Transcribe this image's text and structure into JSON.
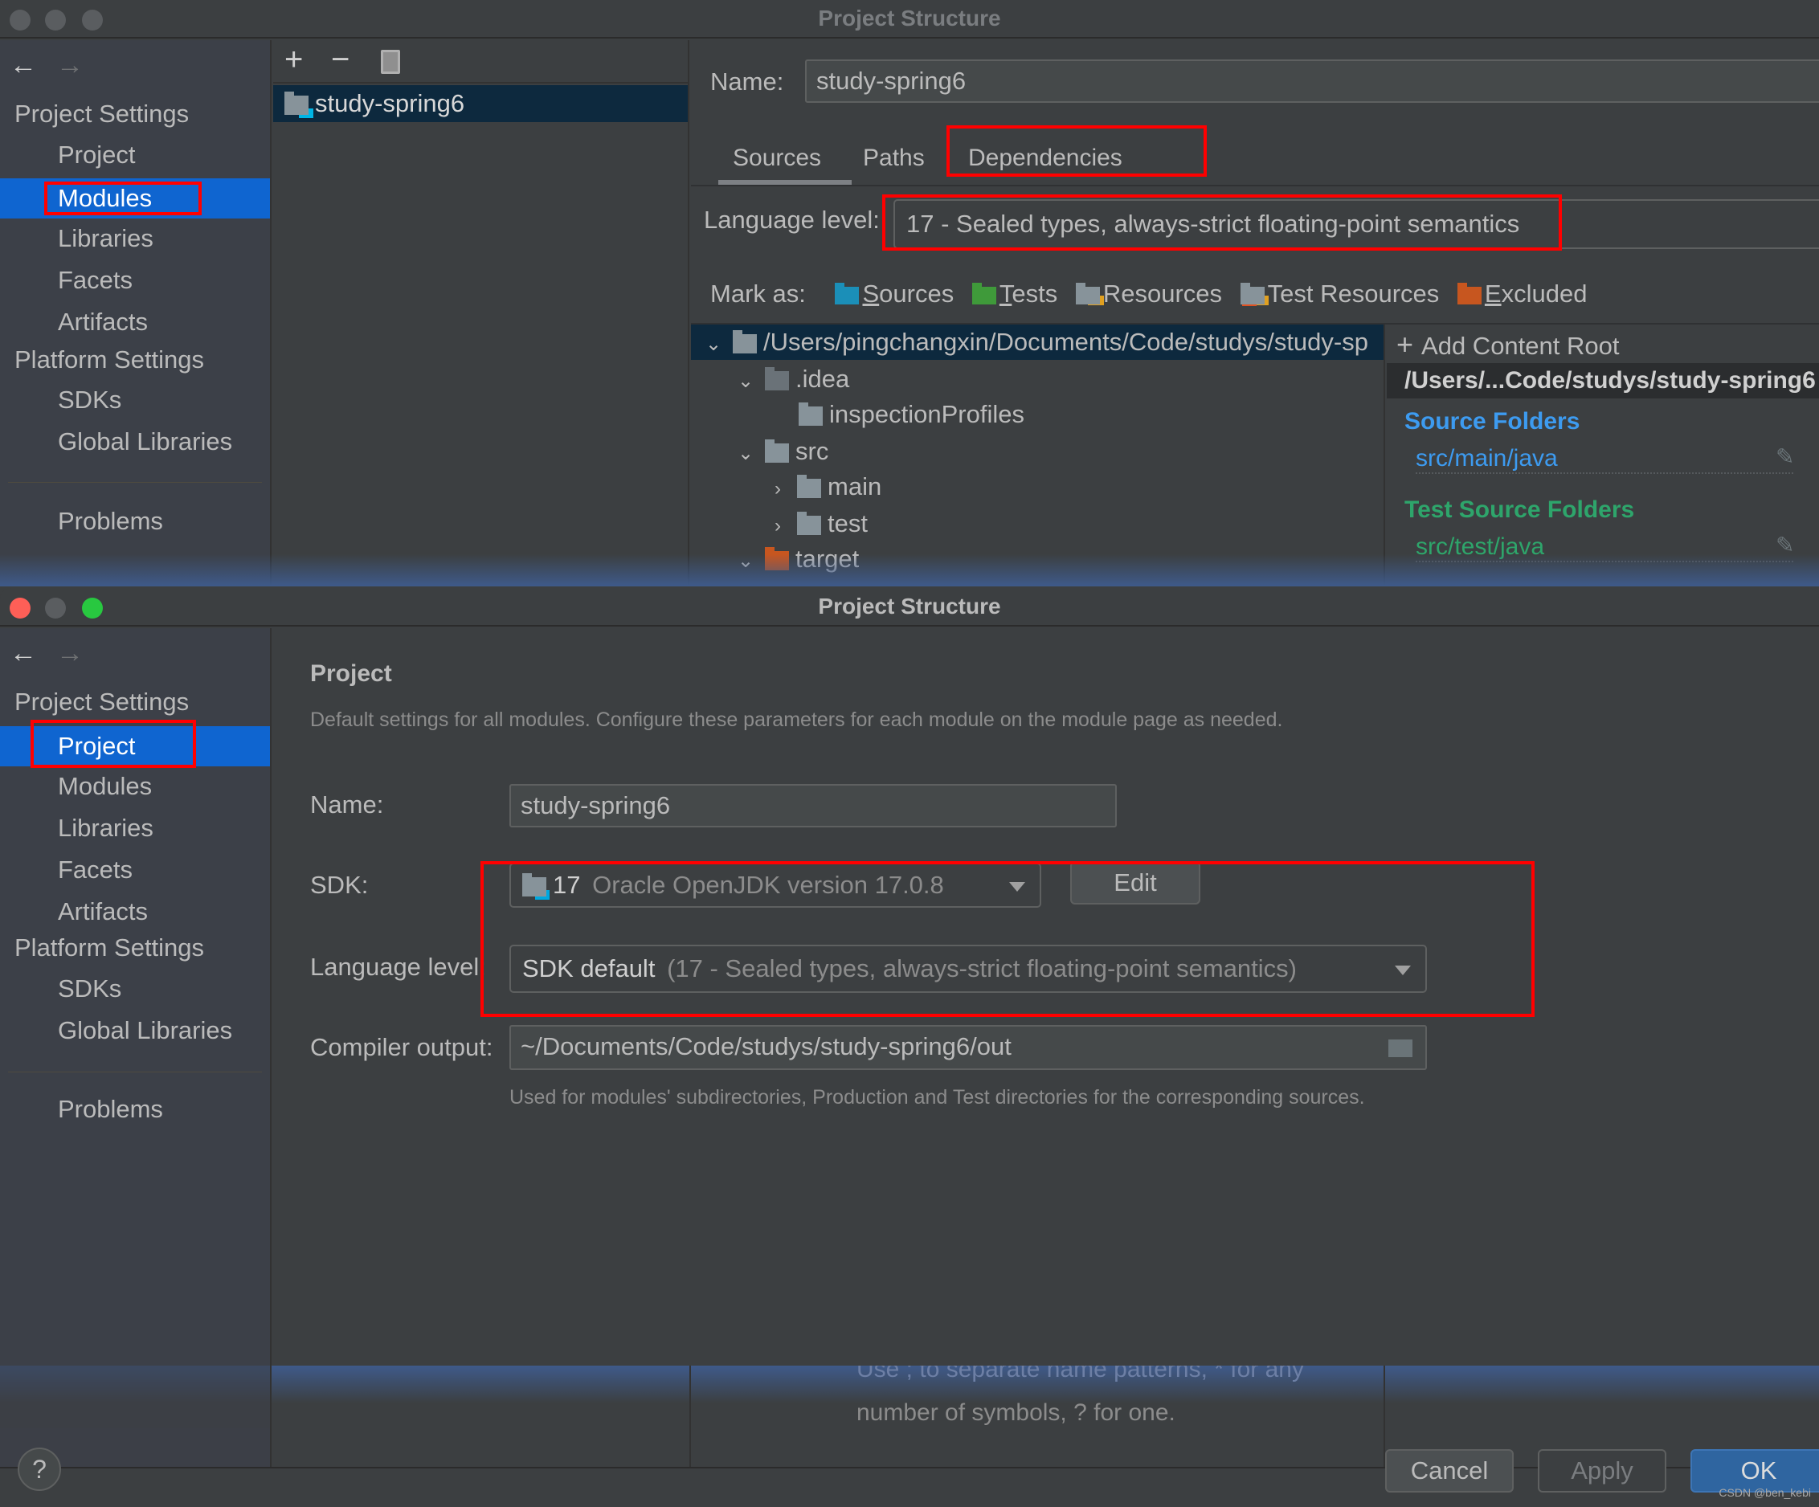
{
  "window_title": "Project Structure",
  "colors": {
    "accent_selection": "#0f65d0",
    "highlight_box": "#ff0000",
    "source_blue": "#3d9bf0",
    "test_green": "#2ea56b",
    "excluded_orange": "#c7561f",
    "ok_button": "#2f65a0"
  },
  "sidebar": {
    "sections": [
      {
        "heading": "Project Settings",
        "items": [
          "Project",
          "Modules",
          "Libraries",
          "Facets",
          "Artifacts"
        ]
      },
      {
        "heading": "Platform Settings",
        "items": [
          "SDKs",
          "Global Libraries"
        ]
      }
    ],
    "problems": "Problems"
  },
  "top_window": {
    "selected_sidebar": "Modules",
    "toolbar": {
      "add": "+",
      "remove": "−",
      "copy": "copy-icon"
    },
    "module_list": [
      "study-spring6"
    ],
    "name_label": "Name:",
    "name_value": "study-spring6",
    "tabs": [
      "Sources",
      "Paths",
      "Dependencies"
    ],
    "active_tab": "Sources",
    "language_level_label": "Language level:",
    "language_level_value": "17 - Sealed types, always-strict floating-point semantics",
    "mark_as_label": "Mark as:",
    "mark_as": [
      {
        "label": "Sources",
        "mnemonic": "S",
        "rest": "ources"
      },
      {
        "label": "Tests",
        "mnemonic": "T",
        "rest": "ests"
      },
      {
        "label": "Resources",
        "mnemonic": "",
        "rest": "Resources"
      },
      {
        "label": "Test Resources",
        "mnemonic": "",
        "rest": "Test Resources"
      },
      {
        "label": "Excluded",
        "mnemonic": "E",
        "rest": "xcluded"
      }
    ],
    "tree": [
      {
        "label": "/Users/pingchangxin/Documents/Code/studys/study-sp",
        "expanded": true,
        "level": 0
      },
      {
        "label": ".idea",
        "expanded": true,
        "level": 1
      },
      {
        "label": "inspectionProfiles",
        "level": 2
      },
      {
        "label": "src",
        "expanded": true,
        "level": 1
      },
      {
        "label": "main",
        "expanded": false,
        "level": 2
      },
      {
        "label": "test",
        "expanded": false,
        "level": 2
      },
      {
        "label": "target",
        "expanded": true,
        "level": 1
      }
    ],
    "content_root": {
      "add_label": "Add Content Root",
      "path": "/Users/...Code/studys/study-spring6",
      "source_folders_heading": "Source Folders",
      "source_folder": "src/main/java",
      "test_folders_heading": "Test Source Folders",
      "test_folder": "src/test/java"
    }
  },
  "bottom_window": {
    "selected_sidebar": "Project",
    "heading": "Project",
    "description": "Default settings for all modules. Configure these parameters for each module on the module page as needed.",
    "name_label": "Name:",
    "name_value": "study-spring6",
    "sdk_label": "SDK:",
    "sdk_version": "17",
    "sdk_name": "Oracle OpenJDK version 17.0.8",
    "edit_label": "Edit",
    "language_level_label": "Language level:",
    "language_level_main": "SDK default",
    "language_level_detail": "(17 - Sealed types, always-strict floating-point semantics)",
    "compiler_output_label": "Compiler output:",
    "compiler_output_value": "~/Documents/Code/studys/study-spring6/out",
    "compiler_hint": "Used for modules' subdirectories, Production and Test directories for the corresponding sources.",
    "behind_text_1": "Use ; to separate name patterns, * for any",
    "behind_text_2": "number of symbols, ? for one.",
    "help_label": "?",
    "cancel_label": "Cancel",
    "apply_label": "Apply",
    "ok_label": "OK",
    "watermark": "CSDN @ben_kebi"
  }
}
